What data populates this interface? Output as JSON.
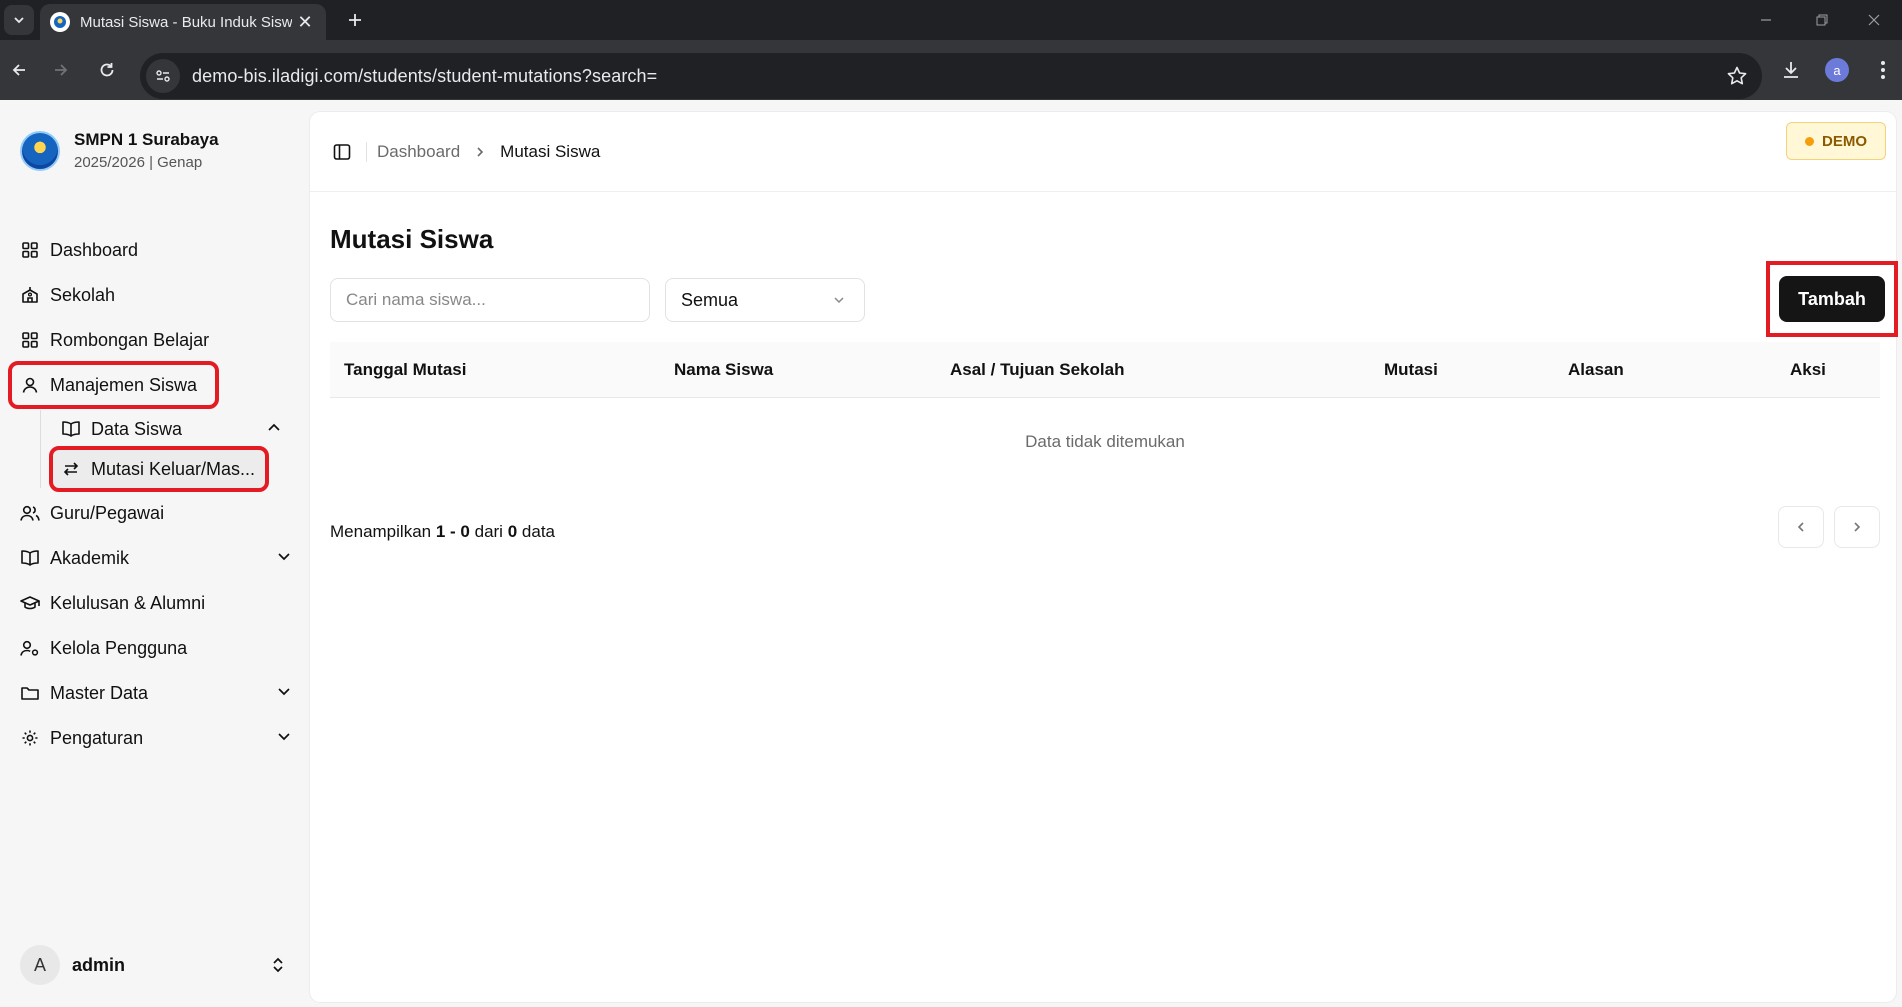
{
  "browser": {
    "tab_title": "Mutasi Siswa - Buku Induk Siswa",
    "url": "demo-bis.iladigi.com/students/student-mutations?search=",
    "profile_initial": "a"
  },
  "sidebar": {
    "school_name": "SMPN 1 Surabaya",
    "school_period": "2025/2026 | Genap",
    "items": [
      {
        "label": "Dashboard"
      },
      {
        "label": "Sekolah"
      },
      {
        "label": "Rombongan Belajar"
      },
      {
        "label": "Manajemen Siswa"
      },
      {
        "label": "Guru/Pegawai"
      },
      {
        "label": "Akademik"
      },
      {
        "label": "Kelulusan & Alumni"
      },
      {
        "label": "Kelola Pengguna"
      },
      {
        "label": "Master Data"
      },
      {
        "label": "Pengaturan"
      }
    ],
    "sub_items": [
      {
        "label": "Data Siswa"
      },
      {
        "label": "Mutasi Keluar/Mas..."
      }
    ],
    "user": {
      "initial": "A",
      "name": "admin"
    }
  },
  "header": {
    "breadcrumb_root": "Dashboard",
    "breadcrumb_current": "Mutasi Siswa",
    "demo_badge": "DEMO"
  },
  "main": {
    "title": "Mutasi Siswa",
    "search_placeholder": "Cari nama siswa...",
    "filter_value": "Semua",
    "add_button": "Tambah",
    "table": {
      "columns": [
        "Tanggal Mutasi",
        "Nama Siswa",
        "Asal / Tujuan Sekolah",
        "Mutasi",
        "Alasan",
        "Aksi"
      ],
      "empty_text": "Data tidak ditemukan"
    },
    "pagination": {
      "prefix": "Menampilkan",
      "range": "1 - 0",
      "of_word": "dari",
      "total": "0",
      "suffix": "data"
    }
  },
  "colors": {
    "highlight": "#e31b23",
    "primary_button": "#151515",
    "demo_badge_bg": "#fff7d6"
  }
}
